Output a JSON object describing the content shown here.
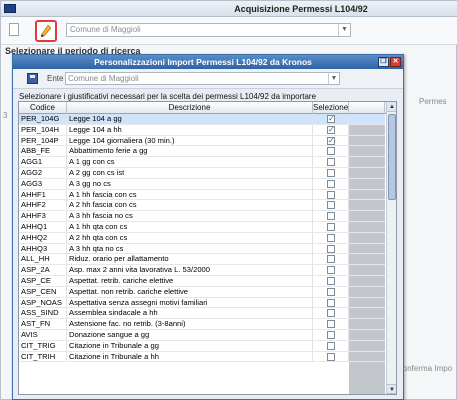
{
  "background_window": {
    "title": "Acquisizione Permessi L104/92",
    "ente_combo_value": "Comune di Maggioli",
    "section_label": "Selezionare il periodo di ricerca",
    "partial_column_label": "Permes",
    "partial_button_label": "Conferma Impo",
    "partial_left_label": "3"
  },
  "dialog": {
    "title": "Personalizzazioni Import Permessi L104/92 da Kronos",
    "ente_label": "Ente",
    "ente_value": "Comune di Maggioli",
    "instruction": "Selezionare i giustificativi necessari per la scelta dei permessi L104/92 da importare",
    "columns": [
      "Codice",
      "Descrizione",
      "Selezione"
    ],
    "rows": [
      {
        "codice": "PER_104G",
        "descrizione": "Legge 104 a gg",
        "selected": true
      },
      {
        "codice": "PER_104H",
        "descrizione": "Legge 104 a hh",
        "selected": true
      },
      {
        "codice": "PER_104P",
        "descrizione": "Legge 104 giornaliera (30 min.)",
        "selected": true
      },
      {
        "codice": "ABB_FE",
        "descrizione": "Abbattimento ferie a gg",
        "selected": false
      },
      {
        "codice": "AGG1",
        "descrizione": "A 1 gg con cs",
        "selected": false
      },
      {
        "codice": "AGG2",
        "descrizione": "A 2 gg con cs ist",
        "selected": false
      },
      {
        "codice": "AGG3",
        "descrizione": "A 3 gg no cs",
        "selected": false
      },
      {
        "codice": "AHHF1",
        "descrizione": "A 1 hh fascia con cs",
        "selected": false
      },
      {
        "codice": "AHHF2",
        "descrizione": "A 2 hh fascia con cs",
        "selected": false
      },
      {
        "codice": "AHHF3",
        "descrizione": "A 3 hh fascia no cs",
        "selected": false
      },
      {
        "codice": "AHHQ1",
        "descrizione": "A 1 hh qta con cs",
        "selected": false
      },
      {
        "codice": "AHHQ2",
        "descrizione": "A 2 hh qta con cs",
        "selected": false
      },
      {
        "codice": "AHHQ3",
        "descrizione": "A 3 hh qta no cs",
        "selected": false
      },
      {
        "codice": "ALL_HH",
        "descrizione": "Riduz. orario per allattamento",
        "selected": false
      },
      {
        "codice": "ASP_2A",
        "descrizione": "Asp. max 2 anni vita lavorativa L. 53/2000",
        "selected": false
      },
      {
        "codice": "ASP_CE",
        "descrizione": "Aspettat. retrib. cariche elettive",
        "selected": false
      },
      {
        "codice": "ASP_CEN",
        "descrizione": "Aspettat. non retrib. cariche elettive",
        "selected": false
      },
      {
        "codice": "ASP_NOAS",
        "descrizione": "Aspettativa senza assegni motivi familiari",
        "selected": false
      },
      {
        "codice": "ASS_SIND",
        "descrizione": "Assemblea sindacale a hh",
        "selected": false
      },
      {
        "codice": "AST_FN",
        "descrizione": "Astensione fac. no retrib. (3-8anni)",
        "selected": false
      },
      {
        "codice": "AVIS",
        "descrizione": "Donazione sangue a gg",
        "selected": false
      },
      {
        "codice": "CIT_TRIG",
        "descrizione": "Citazione in Tribunale a gg",
        "selected": false
      },
      {
        "codice": "CIT_TRIH",
        "descrizione": "Citazione in Tribunale a hh",
        "selected": false
      }
    ]
  },
  "icons": {
    "new_doc": "document-icon",
    "edit": "pencil-icon",
    "save": "save-icon",
    "close": "close-icon",
    "restore": "restore-icon"
  }
}
